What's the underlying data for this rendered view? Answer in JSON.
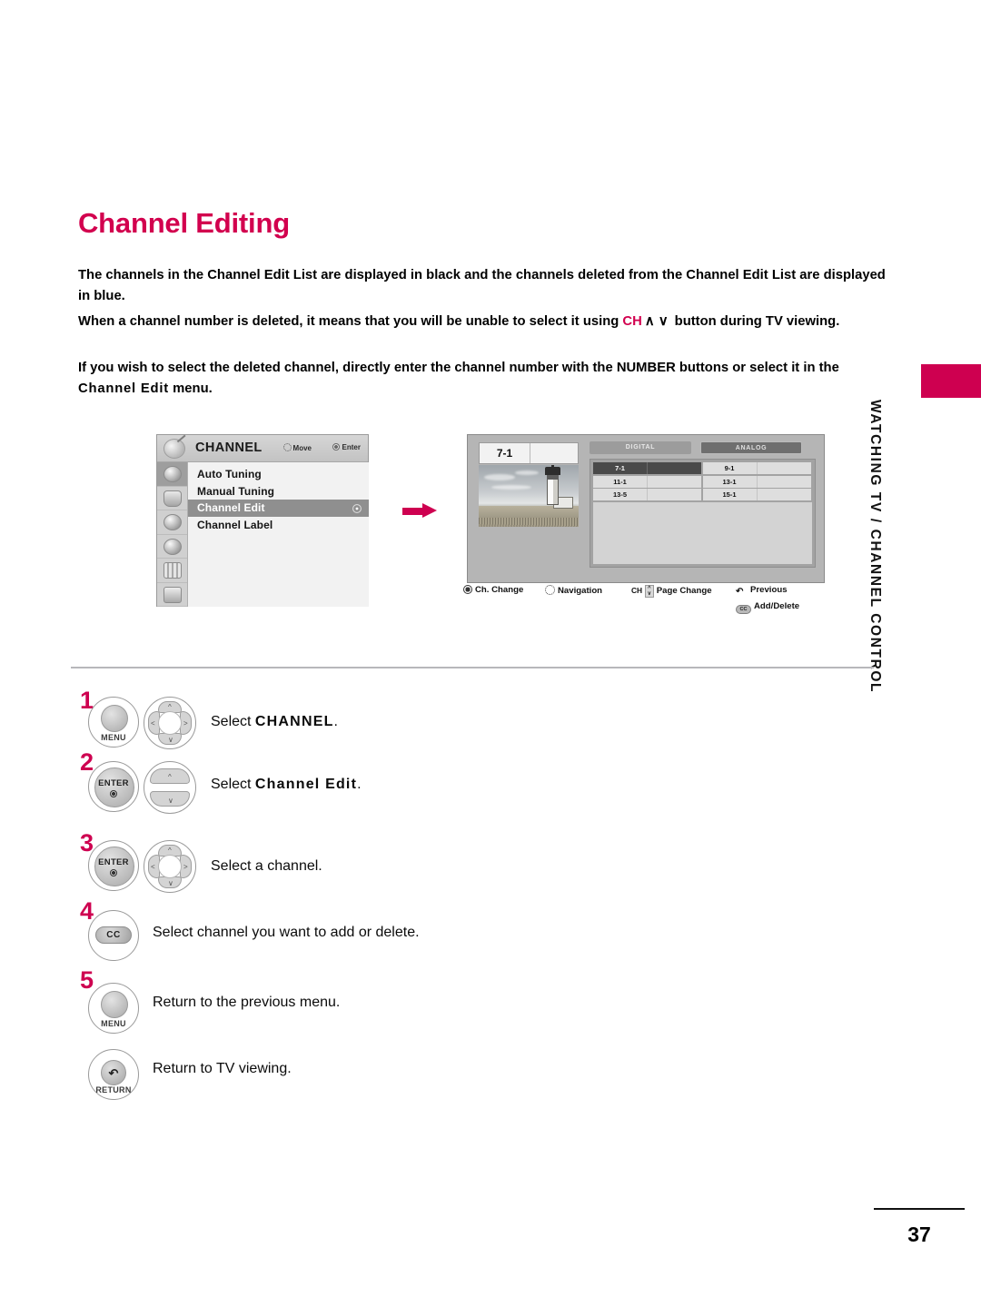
{
  "title": "Channel Editing",
  "paragraphs": {
    "p1_a": "The channels in the Channel Edit List are displayed in black and the channels deleted from the Channel Edit List are displayed in blue.",
    "p2_a": "When a channel number is deleted, it means that you will be unable to select it using ",
    "p2_ch": "CH",
    "p2_arrows": "∧ ∨",
    "p2_b": " button during TV viewing.",
    "p3_a": "If you wish to select the deleted channel, directly enter the channel number with the NUMBER buttons or select it in the ",
    "p3_bold": "Channel Edit",
    "p3_b": " menu."
  },
  "osd_menu": {
    "dish_icon": "satellite-dish-icon",
    "title": "CHANNEL",
    "hint_move": "Move",
    "hint_enter": "Enter",
    "rail_icons": [
      "channel-icon",
      "picture-icon",
      "audio-icon",
      "time-icon",
      "option-icon",
      "lock-icon"
    ],
    "items": [
      {
        "label": "Auto Tuning",
        "selected": false
      },
      {
        "label": "Manual Tuning",
        "selected": false
      },
      {
        "label": "Channel Edit",
        "selected": true
      },
      {
        "label": "Channel Label",
        "selected": false
      }
    ]
  },
  "arrow": {
    "icon": "right-arrow-icon",
    "color": "#CE0050"
  },
  "channel_edit_screen": {
    "preview_channel": "7-1",
    "tabs": [
      {
        "label": "DIGITAL",
        "selected": true
      },
      {
        "label": "ANALOG",
        "selected": false
      }
    ],
    "channel_rows": [
      [
        {
          "num": "7-1",
          "highlighted": true
        },
        {
          "num": "9-1",
          "highlighted": false
        }
      ],
      [
        {
          "num": "11-1",
          "highlighted": false
        },
        {
          "num": "13-1",
          "highlighted": false
        }
      ],
      [
        {
          "num": "13-5",
          "highlighted": false
        },
        {
          "num": "15-1",
          "highlighted": false
        }
      ]
    ],
    "legend": [
      {
        "icon": "enter-dot-icon",
        "label": "Ch. Change"
      },
      {
        "icon": "navigation-pad-icon",
        "label": "Navigation"
      },
      {
        "icon": "ch-updown-icon",
        "prefix": "CH",
        "label": "Page Change"
      },
      {
        "icon": "return-icon",
        "label": "Previous"
      },
      {
        "icon": "cc-button-icon",
        "label": "Add/Delete"
      }
    ]
  },
  "steps": [
    {
      "number": "1",
      "buttons": [
        {
          "kind": "round",
          "label": "MENU",
          "name": "menu-button"
        },
        {
          "kind": "nav4",
          "label": "",
          "name": "navigation-pad-button"
        }
      ],
      "text_pre": "Select ",
      "text_bold": "CHANNEL",
      "text_post": "."
    },
    {
      "number": "2",
      "buttons": [
        {
          "kind": "enter",
          "label": "ENTER",
          "name": "enter-button"
        },
        {
          "kind": "updown",
          "label": "",
          "name": "channel-updown-button"
        }
      ],
      "text_pre": "Select ",
      "text_bold": "Channel Edit",
      "text_post": "."
    },
    {
      "number": "3",
      "buttons": [
        {
          "kind": "enter",
          "label": "ENTER",
          "name": "enter-button"
        },
        {
          "kind": "nav4",
          "label": "",
          "name": "navigation-pad-button"
        }
      ],
      "text_pre": "Select a channel.",
      "text_bold": "",
      "text_post": ""
    },
    {
      "number": "4",
      "buttons": [
        {
          "kind": "cc",
          "label": "CC",
          "name": "cc-button"
        }
      ],
      "text_pre": "Select channel you want to add or delete.",
      "text_bold": "",
      "text_post": ""
    },
    {
      "number": "5",
      "buttons": [
        {
          "kind": "round",
          "label": "MENU",
          "name": "menu-button"
        }
      ],
      "text_pre": "Return to the previous menu.",
      "text_bold": "",
      "text_post": ""
    },
    {
      "number": "",
      "buttons": [
        {
          "kind": "return",
          "label": "RETURN",
          "name": "return-button"
        }
      ],
      "text_pre": "Return to TV viewing.",
      "text_bold": "",
      "text_post": ""
    }
  ],
  "side_tab": {
    "text": "WATCHING TV / CHANNEL CONTROL",
    "accent_color": "#CE0050"
  },
  "footer": {
    "page_number": "37"
  }
}
